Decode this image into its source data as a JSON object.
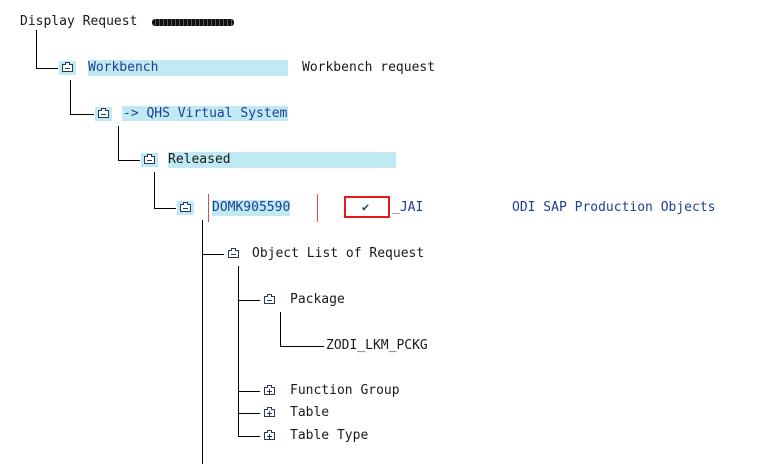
{
  "header": {
    "label": "Display Request"
  },
  "nodes": {
    "workbench": {
      "label": "Workbench",
      "desc": "Workbench request"
    },
    "virtual_system": {
      "label": "-> QHS Virtual System"
    },
    "released": {
      "label": "Released"
    },
    "request": {
      "id": "DOMK905590",
      "owner": "_JAI",
      "desc": "ODI SAP Production Objects",
      "check": "✔"
    },
    "object_list": {
      "label": "Object List of Request"
    },
    "package": {
      "label": "Package"
    },
    "package_item": {
      "label": "ZODI_LKM_PCKG"
    },
    "function_group": {
      "label": "Function Group"
    },
    "table": {
      "label": "Table"
    },
    "table_type": {
      "label": "Table Type"
    }
  },
  "colors": {
    "highlight": "#bfeaf3",
    "selection_border": "#e11b1b",
    "text_blue": "#1f3f8f"
  }
}
